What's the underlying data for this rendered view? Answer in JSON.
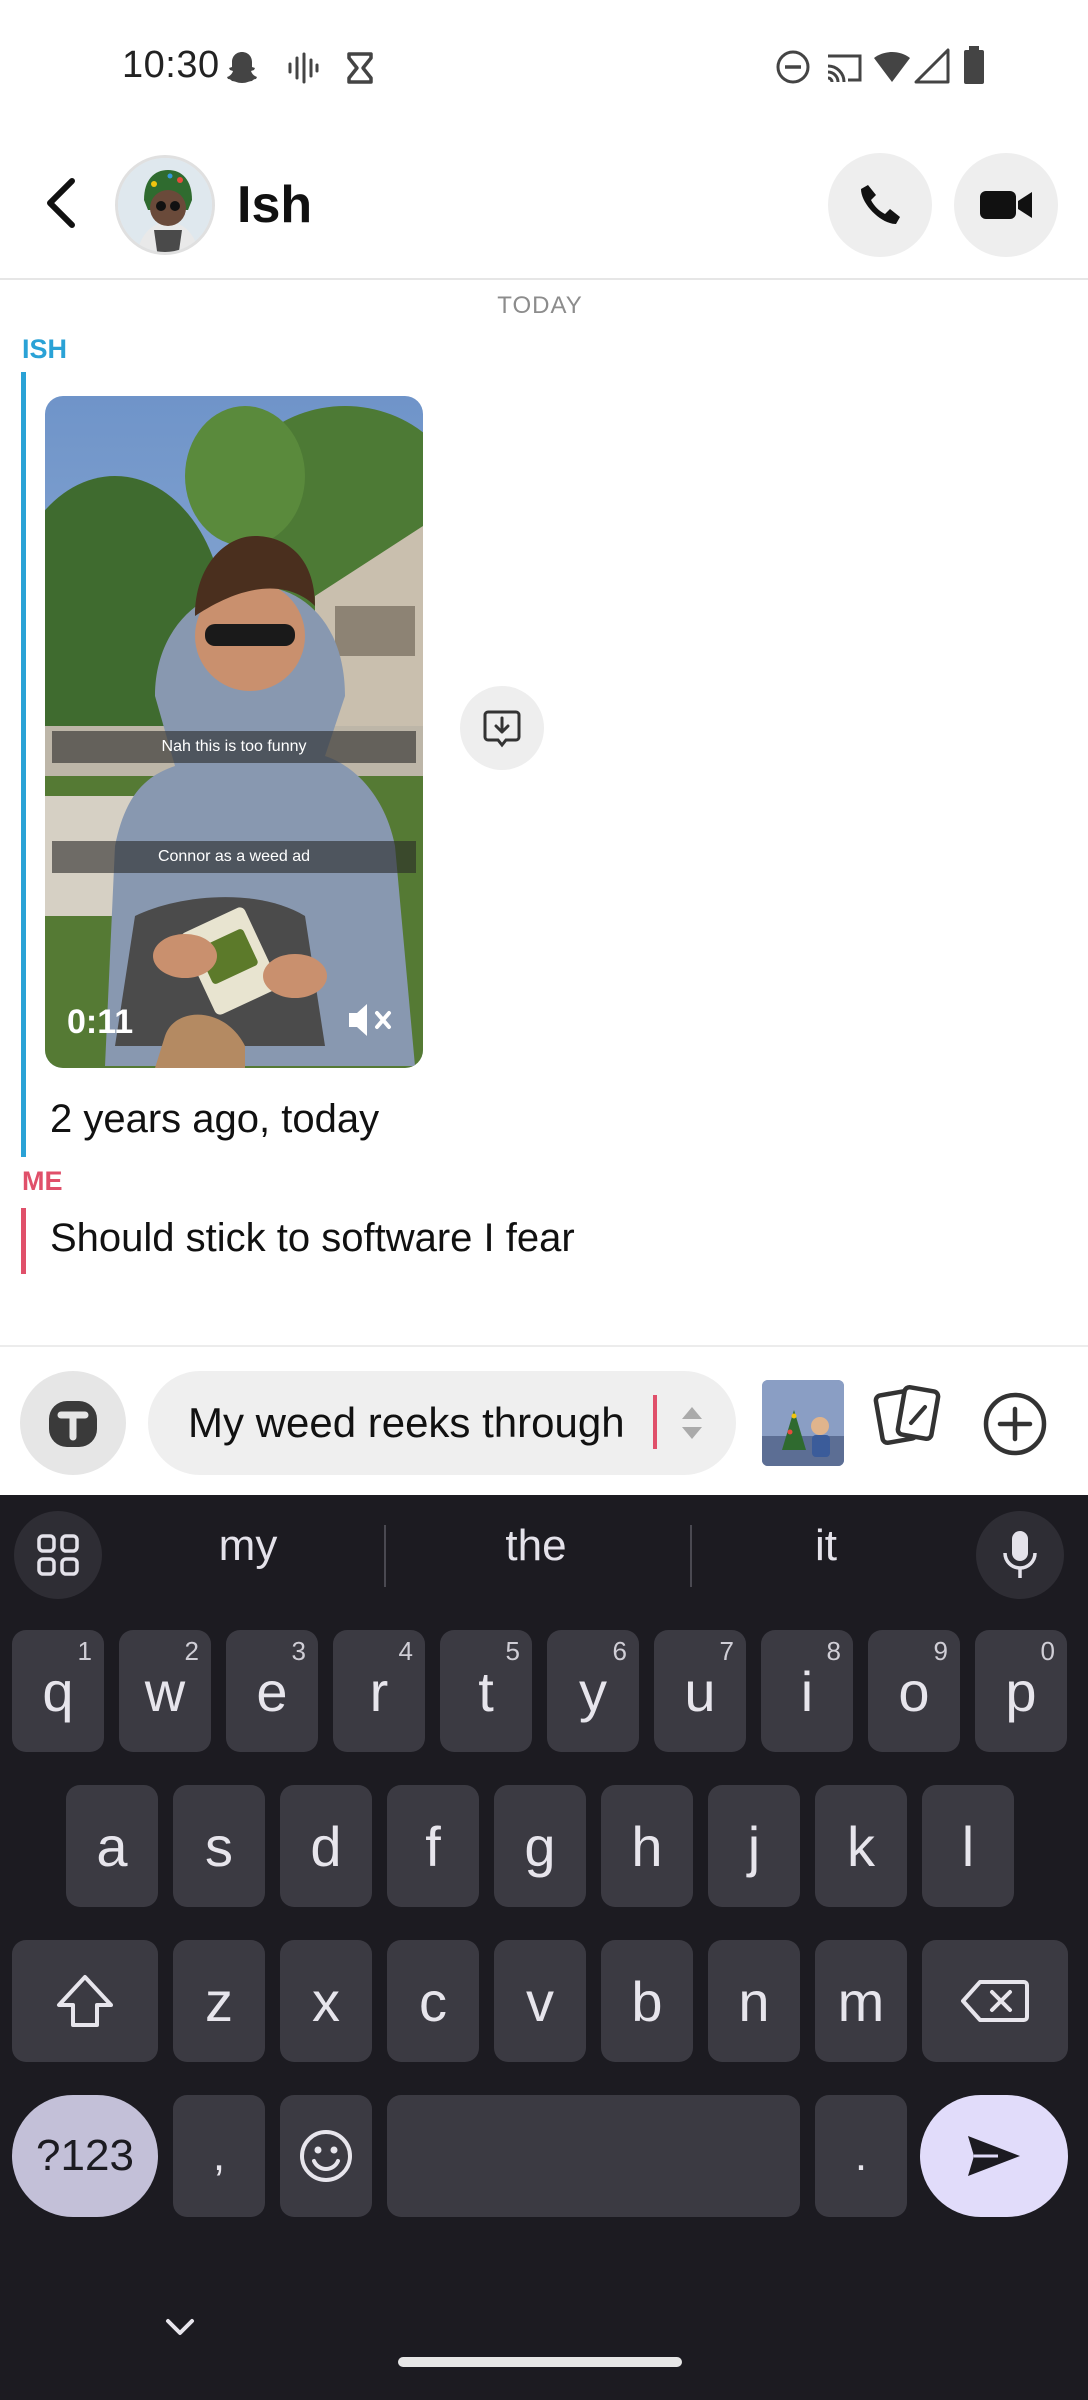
{
  "status_bar": {
    "time": "10:30",
    "left_icons": [
      "snapchat-ghost-icon",
      "voice-wave-icon",
      "hourglass-icon"
    ],
    "right_icons": [
      "do-not-disturb-icon",
      "cast-icon",
      "wifi-icon",
      "cell-signal-icon",
      "battery-icon"
    ]
  },
  "header": {
    "contact_name": "Ish",
    "back_icon": "back-arrow-icon",
    "call_icon": "phone-icon",
    "video_icon": "video-camera-icon"
  },
  "chat": {
    "day_label": "TODAY",
    "messages": [
      {
        "sender": "ISH",
        "media": {
          "captions": [
            "Nah this is too funny",
            "Connor as a weed ad"
          ],
          "duration": "0:11",
          "muted": true
        },
        "text": "2 years ago, today"
      },
      {
        "sender": "ME",
        "text": "Should stick to software I fear"
      }
    ],
    "colors": {
      "ish": "#2aa2d6",
      "me": "#e0506a"
    }
  },
  "composer": {
    "input_value": "My weed reeks through",
    "bitmoji_icon": "bitmoji-icon",
    "cards_icon": "cards-icon",
    "plus_icon": "plus-circle-icon"
  },
  "keyboard": {
    "suggestions": [
      "my",
      "the",
      "it"
    ],
    "row1": [
      {
        "key": "q",
        "hint": "1"
      },
      {
        "key": "w",
        "hint": "2"
      },
      {
        "key": "e",
        "hint": "3"
      },
      {
        "key": "r",
        "hint": "4"
      },
      {
        "key": "t",
        "hint": "5"
      },
      {
        "key": "y",
        "hint": "6"
      },
      {
        "key": "u",
        "hint": "7"
      },
      {
        "key": "i",
        "hint": "8"
      },
      {
        "key": "o",
        "hint": "9"
      },
      {
        "key": "p",
        "hint": "0"
      }
    ],
    "row2": [
      "a",
      "s",
      "d",
      "f",
      "g",
      "h",
      "j",
      "k",
      "l"
    ],
    "row3": [
      "z",
      "x",
      "c",
      "v",
      "b",
      "n",
      "m"
    ],
    "symbols_label": "?123",
    "comma_label": ",",
    "period_label": ".",
    "colors": {
      "background": "#1c1b21",
      "key": "#3b3a42",
      "accent": "#e1dcfa"
    }
  }
}
